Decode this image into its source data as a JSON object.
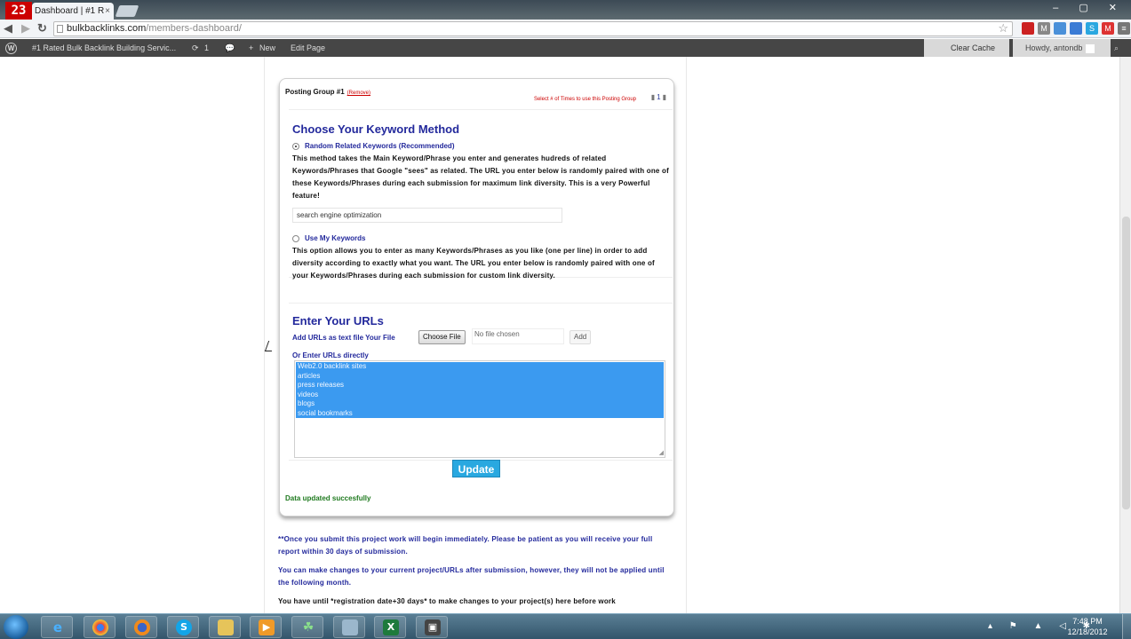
{
  "browser": {
    "badge": "23",
    "tab_title": "Dashboard | #1 R",
    "tab_close": "×",
    "url_domain": "bulkbacklinks.com",
    "url_path": "/members-dashboard/",
    "window_buttons": "– ▢ ✕"
  },
  "adminbar": {
    "site_name": "#1 Rated Bulk Backlink Building Servic...",
    "updates_count": "1",
    "new_label": "New",
    "edit_label": "Edit Page",
    "clear_cache_label": "Clear Cache",
    "howdy_label": "Howdy, antondb"
  },
  "group": {
    "title": "Posting Group #1",
    "remove_label": "(Remove)",
    "select_times_label": "Select # of Times to use this Posting Group"
  },
  "keyword": {
    "heading": "Choose Your Keyword Method",
    "option1_label": "Random Related Keywords (Recommended)",
    "option1_desc": "This method takes the Main Keyword/Phrase you enter and generates hudreds of related Keywords/Phrases that Google \"sees\" as related. The URL you enter below is randomly paired with one of these Keywords/Phrases during each submission for maximum link diversity. This is a very Powerful feature!",
    "main_keyword_value": "search engine optimization",
    "option2_label": "Use My Keywords",
    "option2_desc": "This option allows you to enter as many Keywords/Phrases as you like (one per line) in order to add diversity according to exactly what you want. The URL you enter below is randomly paired with one of your Keywords/Phrases during each submission for custom link diversity."
  },
  "urls": {
    "heading": "Enter Your URLs",
    "add_file_label": "Add URLs as text file Your File",
    "choose_file_label": "Choose File",
    "no_file_label": "No file chosen",
    "add_button_label": "Add",
    "or_enter_label": "Or Enter URLs directly",
    "lines": [
      "Web2.0 backlink sites",
      "articles",
      "press releases",
      "videos",
      "blogs",
      "social bookmarks"
    ]
  },
  "update_button_label": "Update",
  "status_message": "Data updated succesfully",
  "notes": {
    "note1": "**Once you submit this project work will begin immediately. Please be patient as you will receive your full report within 30 days of submission.",
    "note2": "You can make changes to your current project/URLs after submission, however, they will not be applied until the following month.",
    "note3": "You have until *registration date+30 days* to make changes to your project(s) here before work"
  },
  "taskbar": {
    "clock_time": "7:48 PM",
    "clock_date": "12/18/2012"
  }
}
